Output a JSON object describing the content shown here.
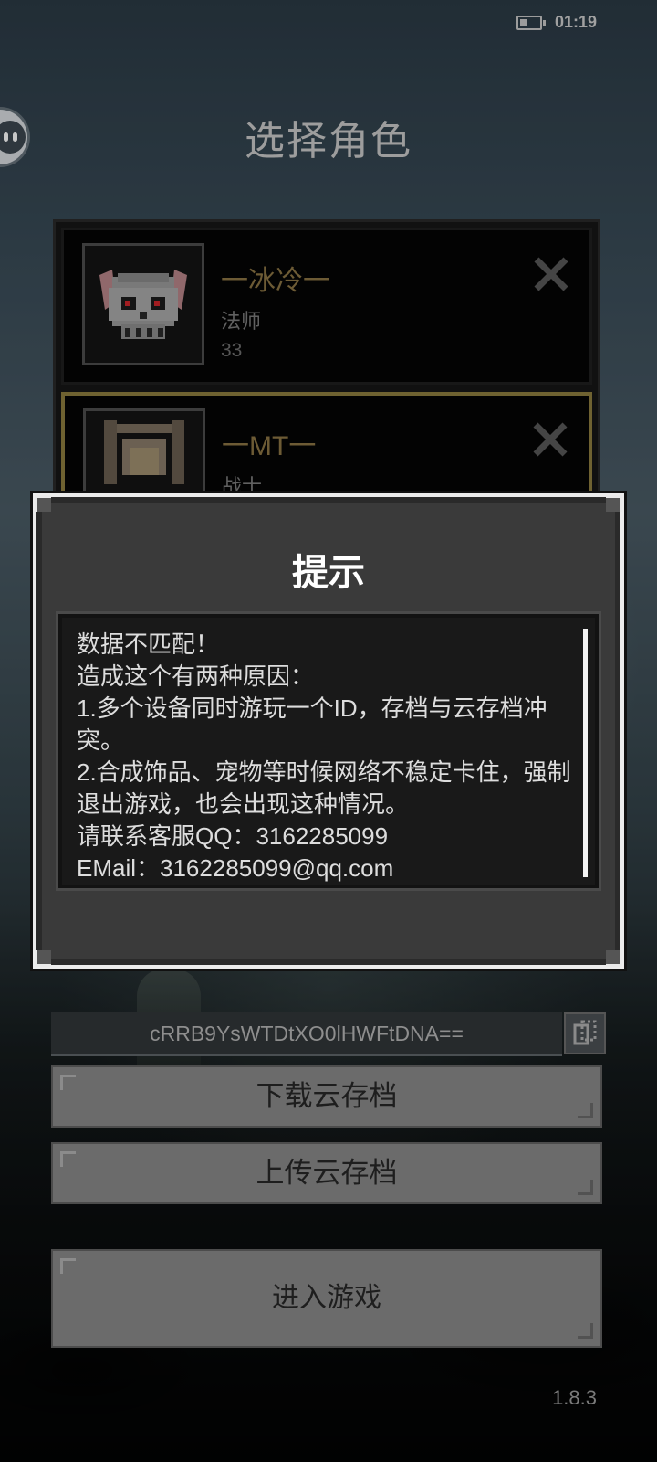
{
  "status_bar": {
    "time": "01:19"
  },
  "page_title": "选择角色",
  "characters": [
    {
      "name": "一冰冷一",
      "class": "法师",
      "level": "33",
      "selected": false
    },
    {
      "name": "一MT一",
      "class": "战士",
      "selected": true
    }
  ],
  "dialog": {
    "title": "提示",
    "lines": [
      "数据不匹配！",
      "造成这个有两种原因：",
      "1.多个设备同时游玩一个ID，存档与云存档冲突。",
      "2.合成饰品、宠物等时候网络不稳定卡住，强制退出游戏，也会出现这种情况。",
      "请联系客服QQ：3162285099",
      "EMail：3162285099@qq.com"
    ]
  },
  "cloud": {
    "id_value": "cRRB9YsWTDtXO0lHWFtDNA=="
  },
  "buttons": {
    "download": "下载云存档",
    "upload": "上传云存档",
    "enter": "进入游戏"
  },
  "version": "1.8.3",
  "colors": {
    "selected_border": "#8f7e3f",
    "name_color": "#8c7544",
    "button_gray": "#6b6b6b"
  },
  "icons": {
    "battery": "battery-icon",
    "delete": "close-x-icon",
    "copy": "copy-icon",
    "assistant": "floating-assistant-icon"
  }
}
